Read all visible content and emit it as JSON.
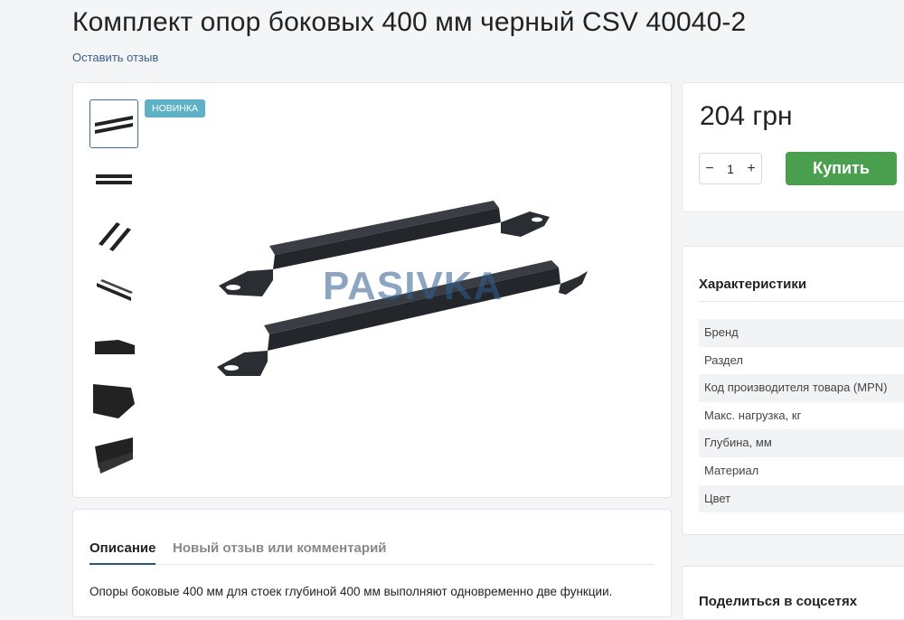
{
  "product": {
    "title": "Комплект опор боковых 400 мм черный CSV 40040-2",
    "review_link": "Оставить отзыв",
    "badge": "НОВИНКА",
    "watermark": "PASIVKA",
    "thumbnails": [
      "image-1",
      "image-2",
      "image-3",
      "image-4",
      "image-5",
      "image-6",
      "image-7"
    ]
  },
  "purchase": {
    "price": "204 грн",
    "quantity": "1",
    "minus": "−",
    "plus": "+",
    "buy_label": "Купить"
  },
  "specs": {
    "title": "Характеристики",
    "rows": [
      "Бренд",
      "Раздел",
      "Код производителя товара (MPN)",
      "Макс. нагрузка, кг",
      "Глубина, мм",
      "Материал",
      "Цвет"
    ]
  },
  "tabs": {
    "description": "Описание",
    "review": "Новый отзыв или комментарий"
  },
  "description": {
    "text": "Опоры боковые 400 мм для стоек глубиной 400 мм выполняют одновременно две функции."
  },
  "share": {
    "title": "Поделиться в соцсетях"
  },
  "colors": {
    "buy": "#4aa04f",
    "badge": "#5db3c5",
    "link": "#3a5e86",
    "active_tab": "#2a5580"
  }
}
